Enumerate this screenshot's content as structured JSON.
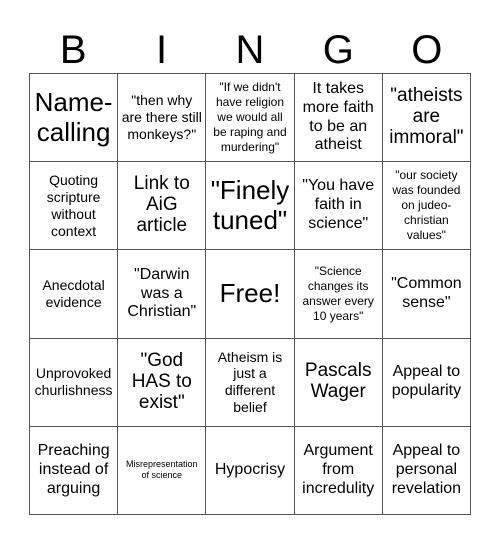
{
  "header": {
    "letters": [
      "B",
      "I",
      "N",
      "G",
      "O"
    ]
  },
  "card": {
    "rows": [
      [
        {
          "text": "Name-calling",
          "size": "xl"
        },
        {
          "text": "\"then why are there still monkeys?\"",
          "size": "s"
        },
        {
          "text": "\"If we didn't have religion we would all be raping and murdering\"",
          "size": "xs"
        },
        {
          "text": "It takes more faith to be an atheist",
          "size": "ms"
        },
        {
          "text": "\"atheists are immoral\"",
          "size": "m"
        }
      ],
      [
        {
          "text": "Quoting scripture without context",
          "size": "s"
        },
        {
          "text": "Link to AiG article",
          "size": "m"
        },
        {
          "text": "\"Finely tuned\"",
          "size": "xl"
        },
        {
          "text": "\"You have faith in science\"",
          "size": "ms"
        },
        {
          "text": "\"our society was founded on judeo-christian values\"",
          "size": "xs"
        }
      ],
      [
        {
          "text": "Anecdotal evidence",
          "size": "s"
        },
        {
          "text": "\"Darwin was a Christian\"",
          "size": "ms"
        },
        {
          "text": "Free!",
          "size": "xl"
        },
        {
          "text": "\"Science changes its answer every 10 years\"",
          "size": "xs"
        },
        {
          "text": "\"Common sense\"",
          "size": "ms"
        }
      ],
      [
        {
          "text": "Unprovoked churlishness",
          "size": "s"
        },
        {
          "text": "\"God HAS to exist\"",
          "size": "m"
        },
        {
          "text": "Atheism is just a different belief",
          "size": "s"
        },
        {
          "text": "Pascals Wager",
          "size": "m"
        },
        {
          "text": "Appeal to popularity",
          "size": "ms"
        }
      ],
      [
        {
          "text": "Preaching instead of arguing",
          "size": "ms"
        },
        {
          "text": "Misrepresentation of science",
          "size": "xxs"
        },
        {
          "text": "Hypocrisy",
          "size": "ms"
        },
        {
          "text": "Argument from incredulity",
          "size": "ms"
        },
        {
          "text": "Appeal to personal revelation",
          "size": "ms"
        }
      ]
    ]
  }
}
